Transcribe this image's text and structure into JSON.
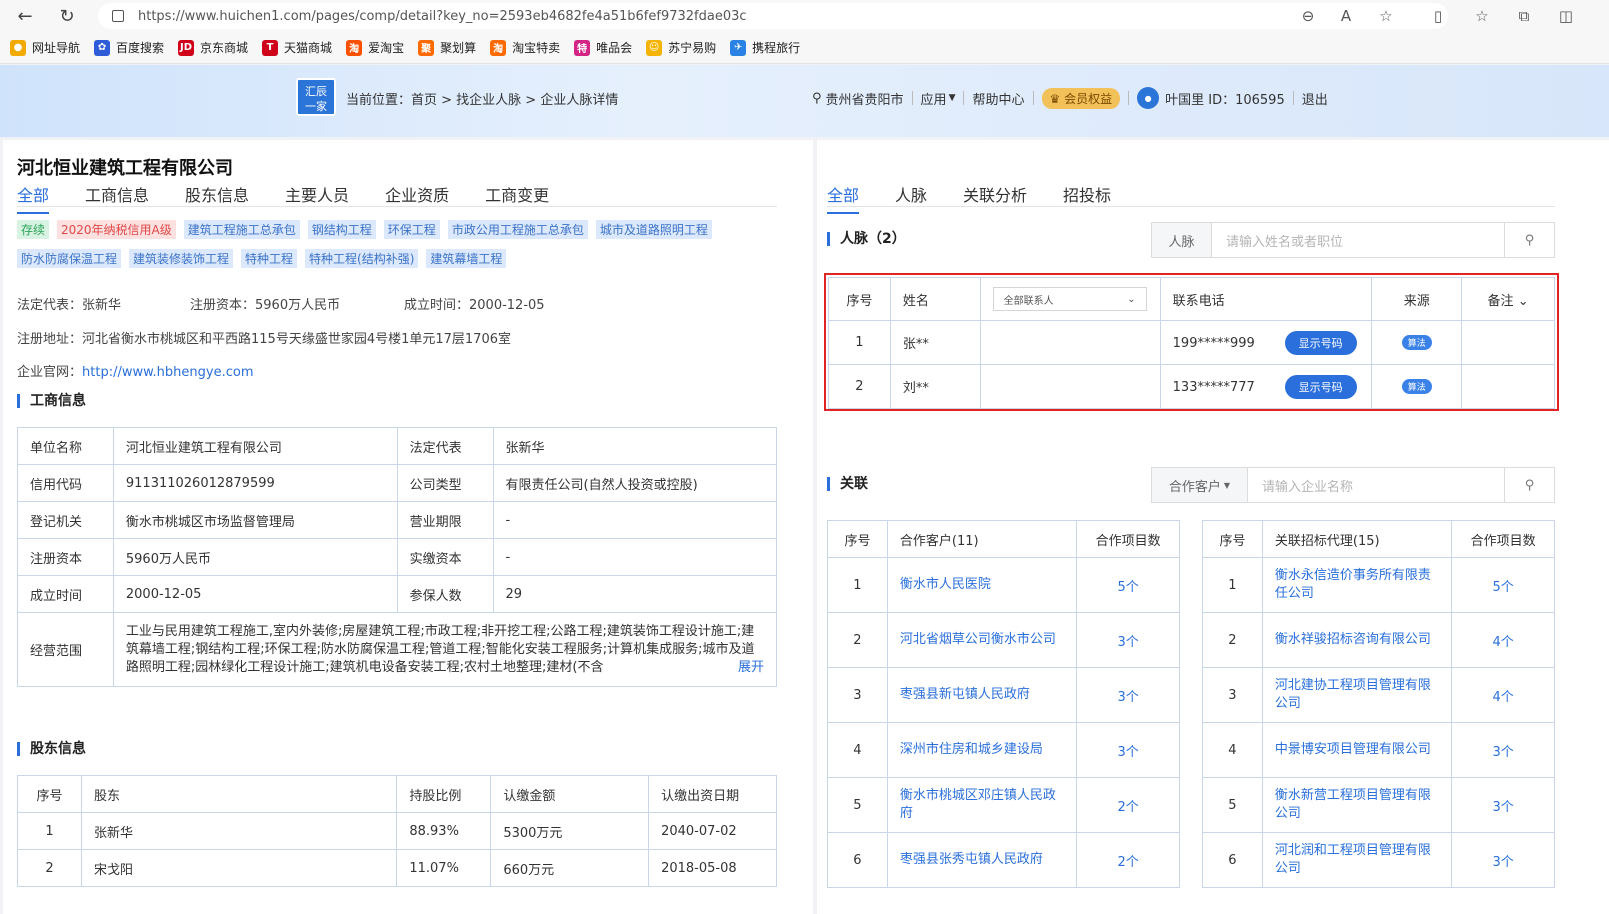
{
  "browser": {
    "url": "https://www.huichen1.com/pages/comp/detail?key_no=2593eb4682fe4a51b6fef9732fdae03c",
    "bookmarks": [
      "网址导航",
      "百度搜索",
      "京东商城",
      "天猫商城",
      "爱淘宝",
      "聚划算",
      "淘宝特卖",
      "唯品会",
      "苏宁易购",
      "携程旅行"
    ],
    "bookmark_icons": [
      {
        "name": "globe-icon",
        "color": "#f2a900",
        "glyph": "●"
      },
      {
        "name": "baidu-icon",
        "color": "#2e5bd8",
        "glyph": "✿"
      },
      {
        "name": "jd-icon",
        "color": "#d0021b",
        "glyph": "JD"
      },
      {
        "name": "tmall-icon",
        "color": "#d0021b",
        "glyph": "T"
      },
      {
        "name": "taobao-icon",
        "color": "#ff5000",
        "glyph": "淘"
      },
      {
        "name": "juhuasuan-icon",
        "color": "#ff6a00",
        "glyph": "聚"
      },
      {
        "name": "taobao-sale-icon",
        "color": "#ff6a00",
        "glyph": "淘"
      },
      {
        "name": "vip-icon",
        "color": "#d42486",
        "glyph": "特"
      },
      {
        "name": "suning-icon",
        "color": "#f5b400",
        "glyph": "☺"
      },
      {
        "name": "ctrip-icon",
        "color": "#2a82e4",
        "glyph": "✈"
      }
    ]
  },
  "header": {
    "logo_line1": "汇辰",
    "logo_line2": "一家",
    "breadcrumb": "当前位置：首页 > 找企业人脉 > 企业人脉详情",
    "location": "贵州省贵阳市",
    "apps": "应用",
    "help": "帮助中心",
    "vip": "会员权益",
    "user": "叶国里 ID：106595",
    "logout": "退出"
  },
  "company": {
    "name": "河北恒业建筑工程有限公司",
    "tabs": [
      "全部",
      "工商信息",
      "股东信息",
      "主要人员",
      "企业资质",
      "工商变更"
    ],
    "tags": [
      {
        "text": "存续",
        "type": "green"
      },
      {
        "text": "2020年纳税信用A级",
        "type": "red"
      },
      {
        "text": "建筑工程施工总承包",
        "type": "blue"
      },
      {
        "text": "钢结构工程",
        "type": "blue"
      },
      {
        "text": "环保工程",
        "type": "blue"
      },
      {
        "text": "市政公用工程施工总承包",
        "type": "blue"
      },
      {
        "text": "城市及道路照明工程",
        "type": "blue"
      },
      {
        "text": "防水防腐保温工程",
        "type": "blue"
      },
      {
        "text": "建筑装修装饰工程",
        "type": "blue"
      },
      {
        "text": "特种工程",
        "type": "blue"
      },
      {
        "text": "特种工程(结构补强)",
        "type": "blue"
      },
      {
        "text": "建筑幕墙工程",
        "type": "blue"
      }
    ],
    "legal_rep": "法定代表：张新华",
    "reg_capital": "注册资本：5960万人民币",
    "founded": "成立时间：2000-12-05",
    "address": "注册地址：河北省衡水市桃城区和平西路115号天缘盛世家园4号楼1单元17层1706室",
    "website_label": "企业官网：",
    "website": "http://www.hbhengye.com"
  },
  "biz_info": {
    "title": "工商信息",
    "rows": [
      [
        "单位名称",
        "河北恒业建筑工程有限公司",
        "法定代表",
        "张新华"
      ],
      [
        "信用代码",
        "911311026012879599",
        "公司类型",
        "有限责任公司(自然人投资或控股)"
      ],
      [
        "登记机关",
        "衡水市桃城区市场监督管理局",
        "营业期限",
        "-"
      ],
      [
        "注册资本",
        "5960万人民币",
        "实缴资本",
        "-"
      ],
      [
        "成立时间",
        "2000-12-05",
        "参保人数",
        "29"
      ]
    ],
    "scope_label": "经营范围",
    "scope_text": "工业与民用建筑工程施工,室内外装修;房屋建筑工程;市政工程;非开挖工程;公路工程;建筑装饰工程设计施工;建筑幕墙工程;钢结构工程;环保工程;防水防腐保温工程;管道工程;智能化安装工程服务;计算机集成服务;城市及道路照明工程;园林绿化工程设计施工;建筑机电设备安装工程;农村土地整理;建材(不含",
    "expand": "展开"
  },
  "shareholders": {
    "title": "股东信息",
    "headers": [
      "序号",
      "股东",
      "持股比例",
      "认缴金额",
      "认缴出资日期"
    ],
    "rows": [
      [
        "1",
        "张新华",
        "88.93%",
        "5300万元",
        "2040-07-02"
      ],
      [
        "2",
        "宋戈阳",
        "11.07%",
        "660万元",
        "2018-05-08"
      ]
    ]
  },
  "right": {
    "tabs": [
      "全部",
      "人脉",
      "关联分析",
      "招投标"
    ],
    "contacts_title": "人脉（2）",
    "contacts_search_prefix": "人脉",
    "contacts_search_placeholder": "请输入姓名或者职位",
    "contacts_headers": [
      "序号",
      "姓名",
      "全部联系人",
      "联系电话",
      "来源",
      "备注"
    ],
    "contacts": [
      {
        "no": "1",
        "name": "张**",
        "phone": "199*****999",
        "btn": "显示号码",
        "source": "算法"
      },
      {
        "no": "2",
        "name": "刘**",
        "phone": "133*****777",
        "btn": "显示号码",
        "source": "算法"
      }
    ],
    "related_title": "关联",
    "related_search_prefix": "合作客户",
    "related_search_placeholder": "请输入企业名称",
    "clients_headers": [
      "序号",
      "合作客户(11)",
      "合作项目数"
    ],
    "clients": [
      [
        "1",
        "衡水市人民医院",
        "5个"
      ],
      [
        "2",
        "河北省烟草公司衡水市公司",
        "3个"
      ],
      [
        "3",
        "枣强县新屯镇人民政府",
        "3个"
      ],
      [
        "4",
        "深州市住房和城乡建设局",
        "3个"
      ],
      [
        "5",
        "衡水市桃城区邓庄镇人民政府",
        "2个"
      ],
      [
        "6",
        "枣强县张秀屯镇人民政府",
        "2个"
      ]
    ],
    "agents_headers": [
      "序号",
      "关联招标代理(15)",
      "合作项目数"
    ],
    "agents": [
      [
        "1",
        "衡水永信造价事务所有限责任公司",
        "5个"
      ],
      [
        "2",
        "衡水祥骏招标咨询有限公司",
        "4个"
      ],
      [
        "3",
        "河北建协工程项目管理有限公司",
        "4个"
      ],
      [
        "4",
        "中景博安项目管理有限公司",
        "3个"
      ],
      [
        "5",
        "衡水新营工程项目管理有限公司",
        "3个"
      ],
      [
        "6",
        "河北润和工程项目管理有限公司",
        "3个"
      ]
    ]
  }
}
